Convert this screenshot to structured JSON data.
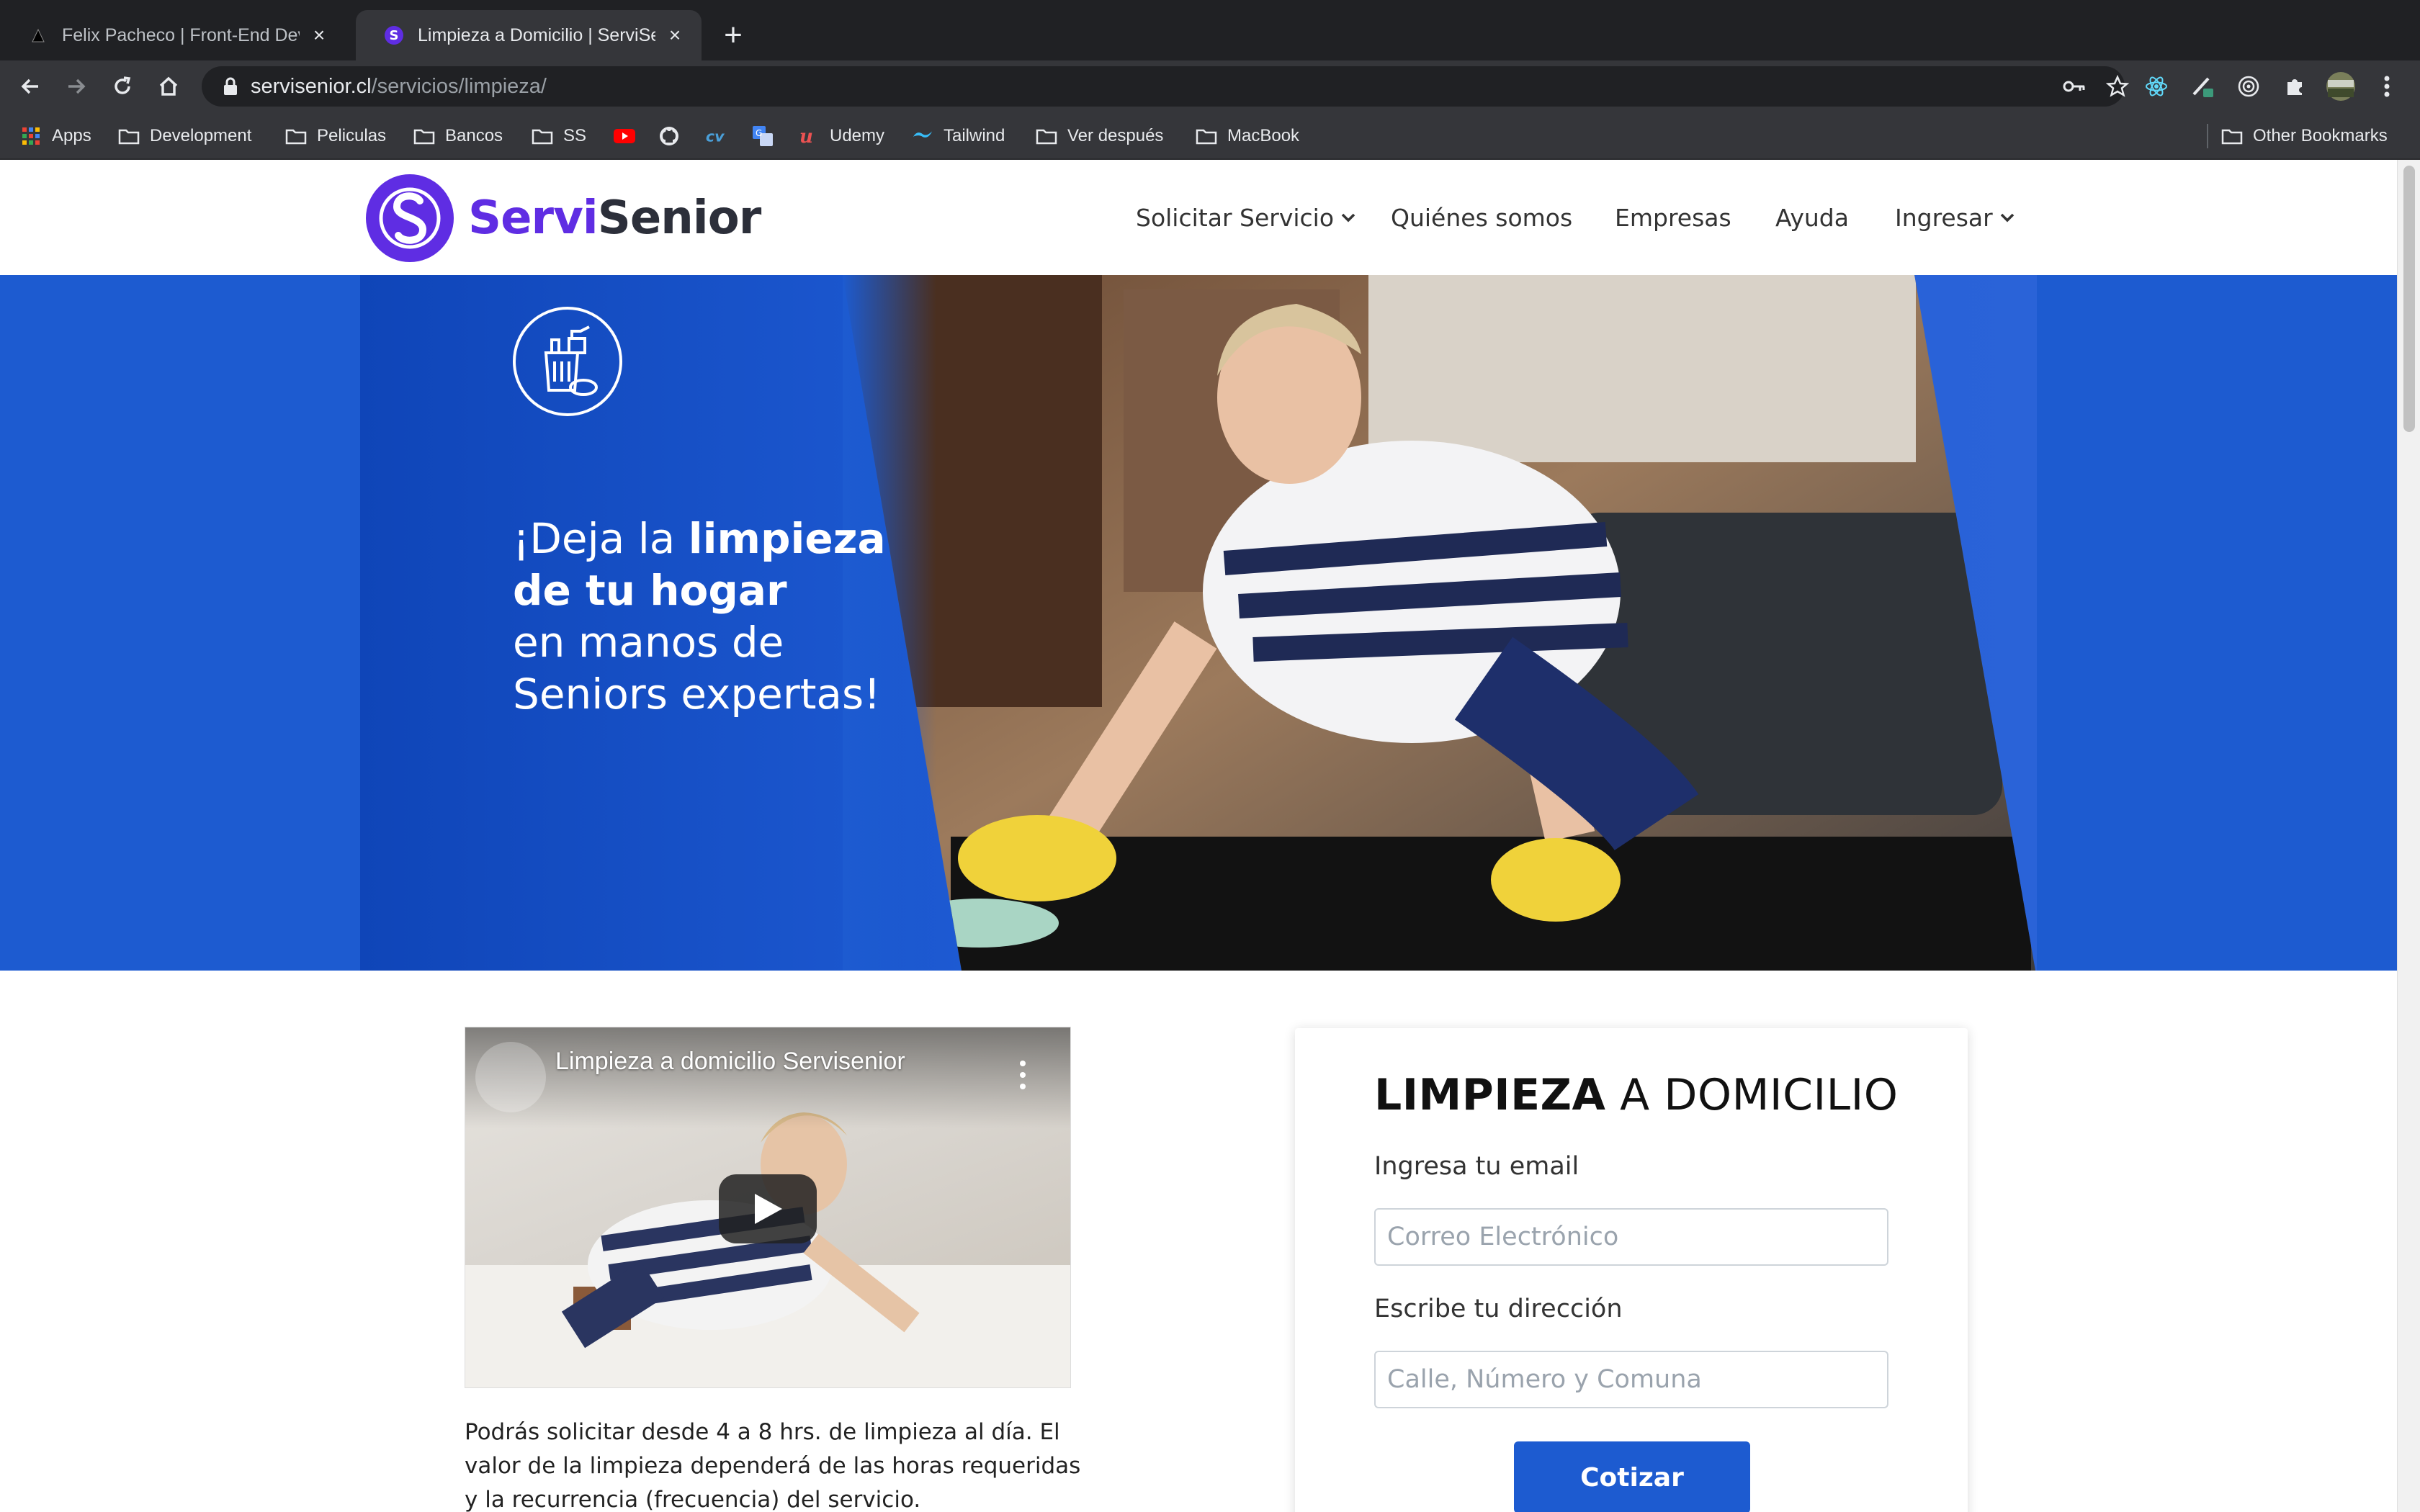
{
  "browser": {
    "tabs": [
      {
        "title": "Felix Pacheco | Front-End Developer",
        "active": false
      },
      {
        "title": "Limpieza a Domicilio | ServiSenior",
        "active": true
      }
    ],
    "url_host": "servisenior.cl",
    "url_path": "/servicios/limpieza/",
    "bookmarks": [
      "Apps",
      "Development",
      "Peliculas",
      "Bancos",
      "SS",
      "Udemy",
      "Tailwind",
      "Ver después",
      "MacBook"
    ],
    "other_bookmarks": "Other Bookmarks"
  },
  "site": {
    "logo_part1": "Servi",
    "logo_part2": "Senior",
    "brand_color": "#5f2de3",
    "accent_color": "#1d5bd0",
    "nav": [
      "Solicitar Servicio",
      "Quiénes somos",
      "Empresas",
      "Ayuda",
      "Ingresar"
    ]
  },
  "hero": {
    "line1_a": "¡Deja la ",
    "line1_b": "limpieza",
    "line2": "de tu hogar",
    "line3": "en manos de",
    "line4": "Seniors expertas!"
  },
  "video": {
    "title": "Limpieza a domicilio Servisenior"
  },
  "description": "Podrás solicitar desde 4 a 8 hrs. de limpieza al día. El valor de la limpieza dependerá de las horas requeridas y la recurrencia (frecuencia) del servicio.",
  "form": {
    "title_bold": "LIMPIEZA",
    "title_rest": " A DOMICILIO",
    "email_label": "Ingresa tu email",
    "email_placeholder": "Correo Electrónico",
    "address_label": "Escribe tu dirección",
    "address_placeholder": "Calle, Número y Comuna",
    "submit": "Cotizar"
  }
}
